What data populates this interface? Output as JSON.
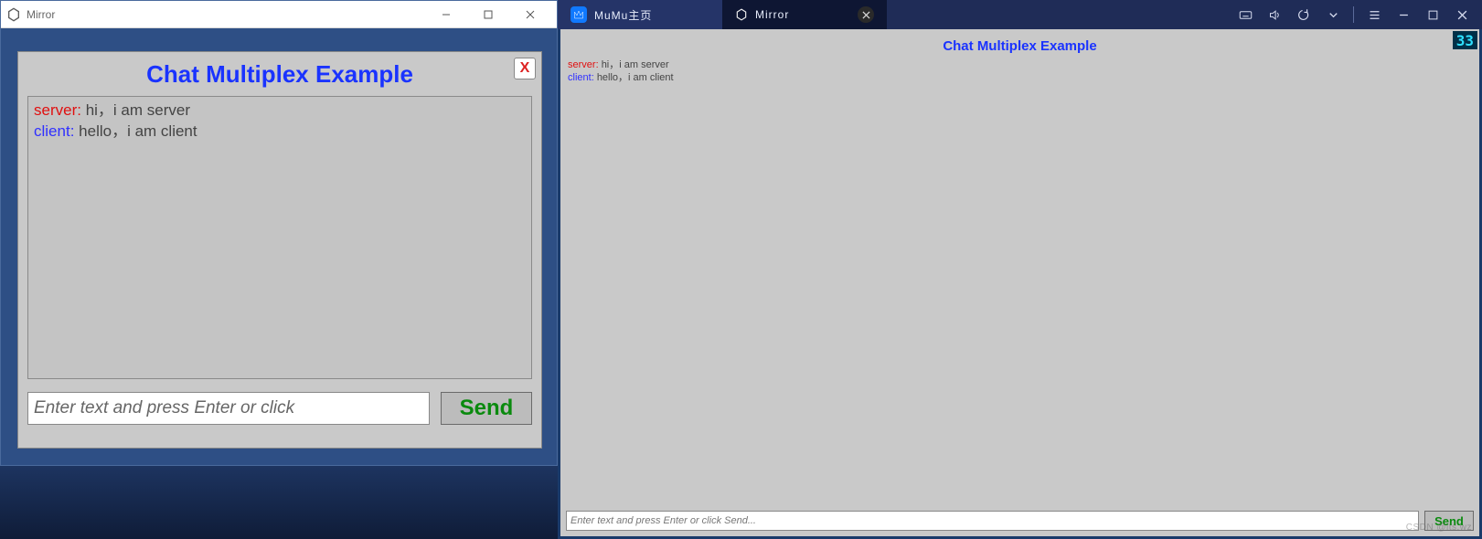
{
  "left_window": {
    "os_title": "Mirror",
    "panel_title": "Chat Multiplex Example",
    "close_x": "X",
    "messages": [
      {
        "sender": "server",
        "text": "hi，i am server"
      },
      {
        "sender": "client",
        "text": "hello，i am client"
      }
    ],
    "input_placeholder": "Enter text and press Enter or click",
    "send_label": "Send"
  },
  "right_window": {
    "tabs": [
      {
        "label": "MuMu主页",
        "kind": "home"
      },
      {
        "label": "Mirror",
        "kind": "active"
      }
    ],
    "fps": "33",
    "panel_title": "Chat Multiplex Example",
    "messages": [
      {
        "sender": "server",
        "text": "hi，i am server"
      },
      {
        "sender": "client",
        "text": "hello，i am client"
      }
    ],
    "input_placeholder": "Enter text and press Enter or click Send...",
    "send_label": "Send",
    "watermark": "CSDN @its.wz"
  }
}
